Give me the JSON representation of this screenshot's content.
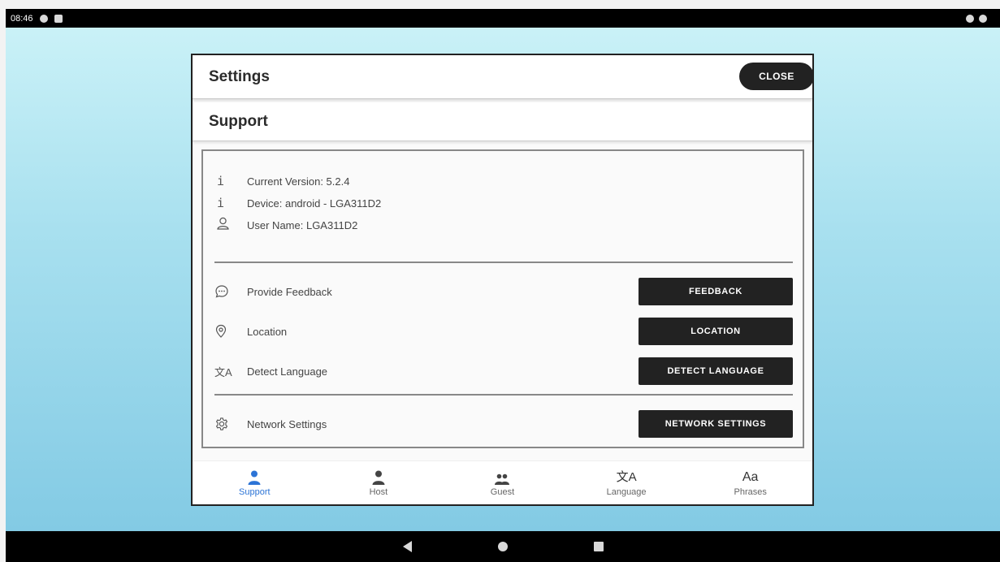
{
  "status_bar": {
    "time": "08:46"
  },
  "dialog": {
    "title": "Settings",
    "close_label": "CLOSE",
    "section_title": "Support"
  },
  "info": [
    {
      "icon": "info-icon",
      "glyph": "i",
      "text": "Current Version: 5.2.4"
    },
    {
      "icon": "info-icon",
      "glyph": "i",
      "text": "Device: android - LGA311D2"
    },
    {
      "icon": "user-icon",
      "text": "User Name: LGA311D2"
    }
  ],
  "actions": [
    {
      "icon": "chat-bubble-icon",
      "label": "Provide Feedback",
      "button": "FEEDBACK"
    },
    {
      "icon": "location-pin-icon",
      "label": "Location",
      "button": "LOCATION"
    },
    {
      "icon": "translate-icon",
      "label": "Detect Language",
      "button": "DETECT LANGUAGE"
    },
    {
      "icon": "gear-icon",
      "label": "Network Settings",
      "button": "NETWORK SETTINGS"
    }
  ],
  "tabs": [
    {
      "label": "Support",
      "icon": "person-icon",
      "active": true
    },
    {
      "label": "Host",
      "icon": "person-icon"
    },
    {
      "label": "Guest",
      "icon": "group-icon"
    },
    {
      "label": "Language",
      "icon": "translate-icon",
      "glyph": "文A"
    },
    {
      "label": "Phrases",
      "icon": "text-icon",
      "glyph": "Aa"
    }
  ],
  "colors": {
    "accent": "#2c74d6",
    "button": "#222222"
  }
}
